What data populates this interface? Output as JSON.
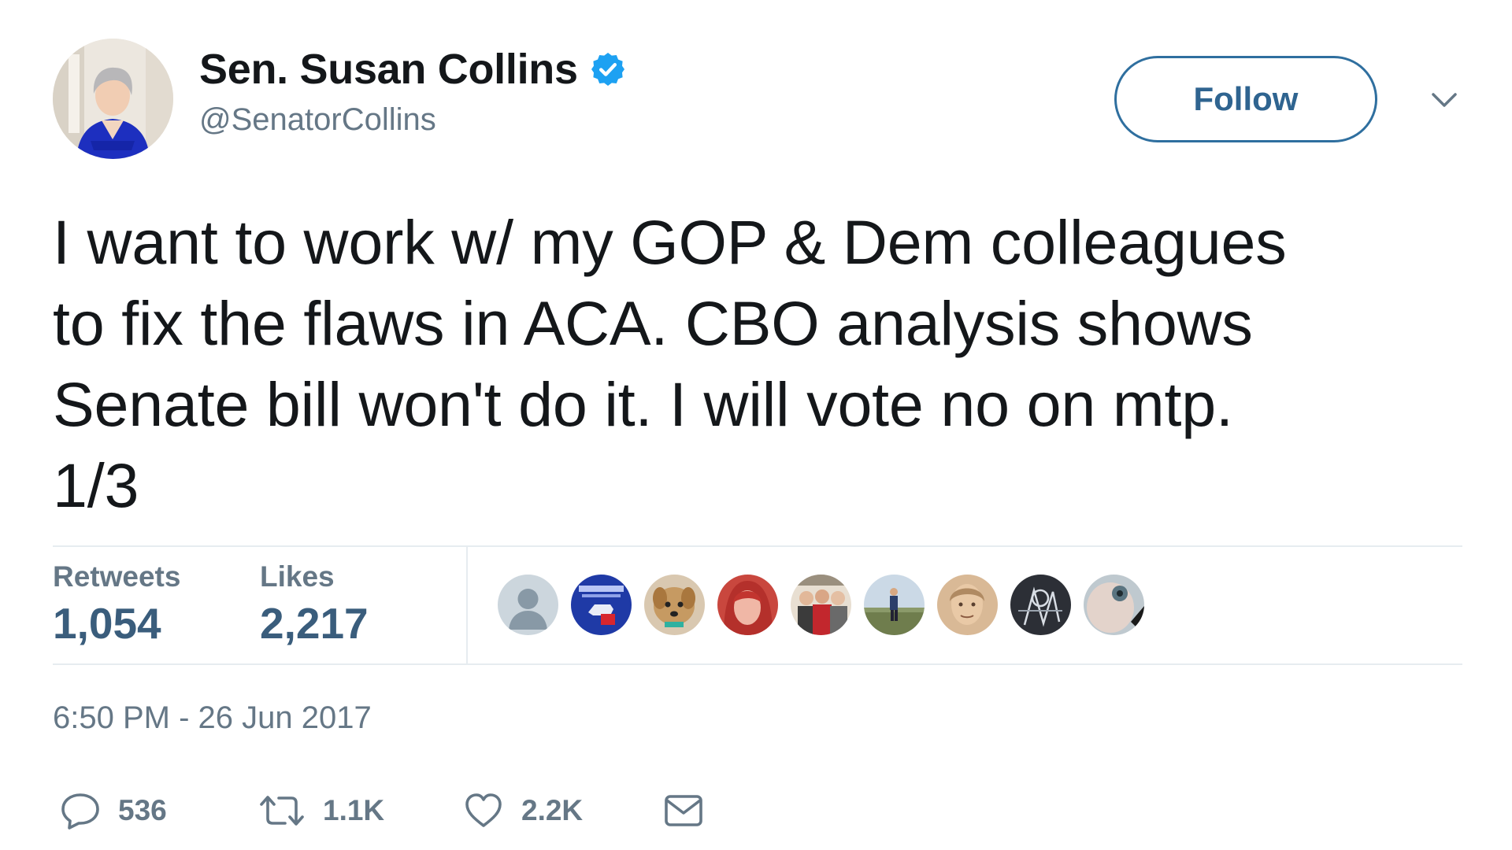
{
  "author": {
    "display_name": "Sen. Susan Collins",
    "handle": "@SenatorCollins",
    "verified": true,
    "avatar_icon": "profile-photo"
  },
  "header": {
    "follow_label": "Follow",
    "menu_icon": "chevron-down-icon"
  },
  "tweet": {
    "text": "I want to work w/ my GOP & Dem colleagues\nto fix the flaws in ACA. CBO analysis shows\nSenate bill won't do it. I will vote no on mtp.\n1/3"
  },
  "stats": {
    "retweets_label": "Retweets",
    "retweets_value": "1,054",
    "likes_label": "Likes",
    "likes_value": "2,217"
  },
  "likers": [
    {
      "icon": "default-avatar-icon"
    },
    {
      "icon": "donkey-logo-avatar"
    },
    {
      "icon": "dog-avatar"
    },
    {
      "icon": "red-hair-avatar"
    },
    {
      "icon": "group-photo-avatar"
    },
    {
      "icon": "field-person-avatar"
    },
    {
      "icon": "portrait-avatar"
    },
    {
      "icon": "sketch-avatar"
    },
    {
      "icon": "closeup-avatar"
    }
  ],
  "timestamp": "6:50 PM - 26 Jun 2017",
  "actions": {
    "reply_count": "536",
    "retweet_count": "1.1K",
    "like_count": "2.2K"
  },
  "colors": {
    "text": "#14171a",
    "secondary": "#657786",
    "stat_value": "#3a5d7c",
    "verified": "#1da1f2",
    "divider": "#e6ecf0",
    "follow_border": "#2f6f9f"
  }
}
